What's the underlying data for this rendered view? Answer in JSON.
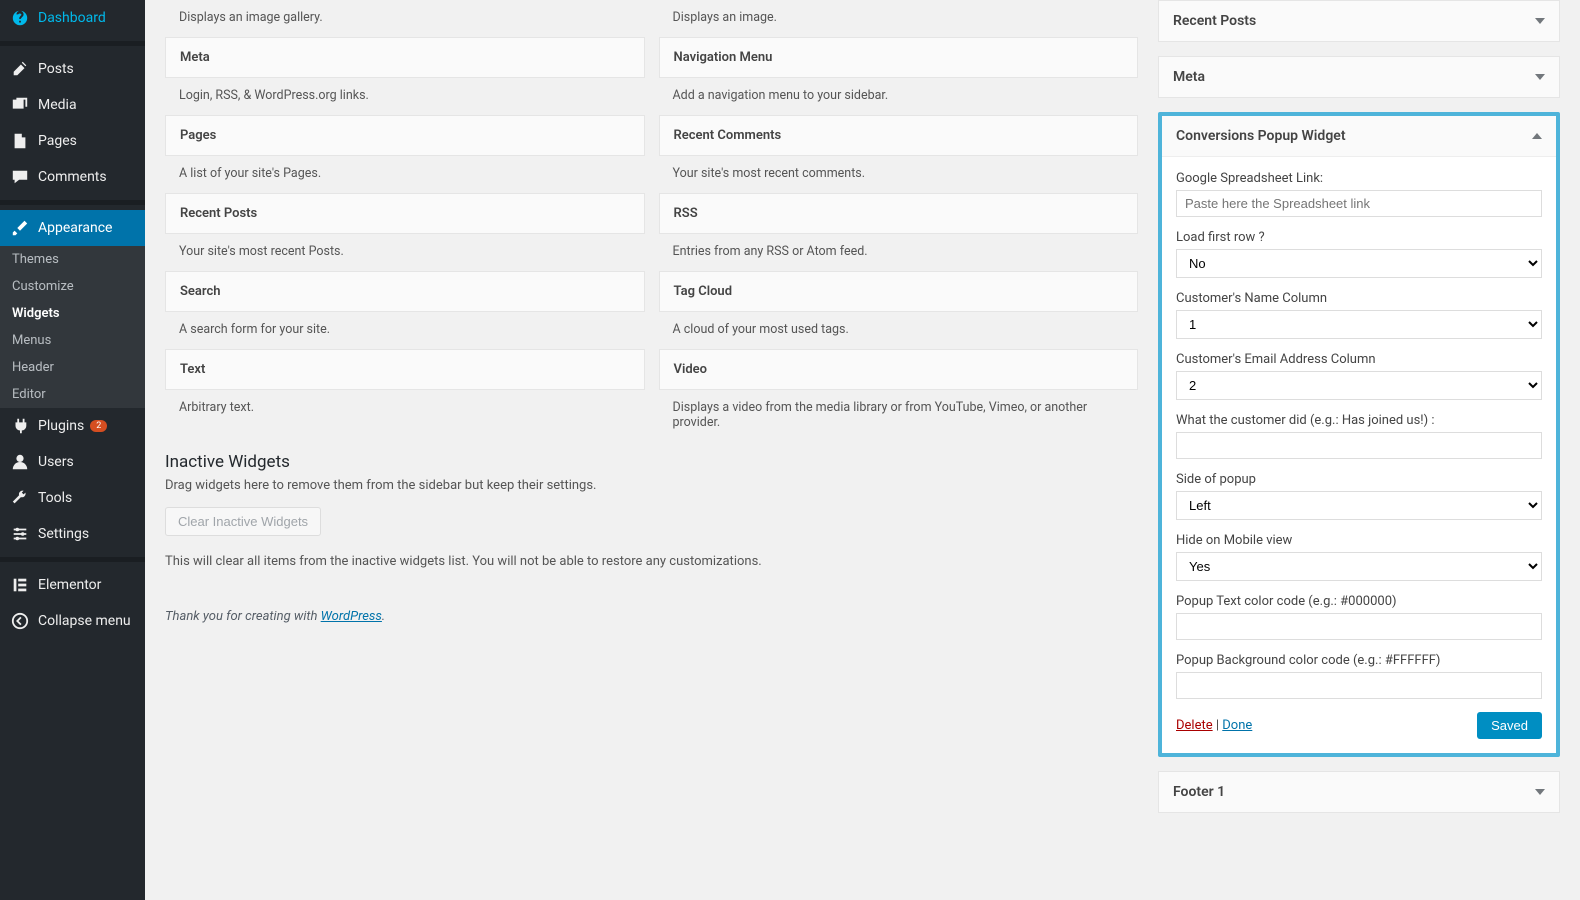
{
  "sidebar": {
    "items": [
      {
        "label": "Dashboard",
        "icon": "dashboard-icon"
      },
      {
        "label": "Posts",
        "icon": "pin-icon"
      },
      {
        "label": "Media",
        "icon": "media-icon"
      },
      {
        "label": "Pages",
        "icon": "page-icon"
      },
      {
        "label": "Comments",
        "icon": "comment-icon"
      },
      {
        "label": "Appearance",
        "icon": "brush-icon",
        "active": true
      },
      {
        "label": "Plugins",
        "icon": "plug-icon",
        "badge": "2"
      },
      {
        "label": "Users",
        "icon": "user-icon"
      },
      {
        "label": "Tools",
        "icon": "wrench-icon"
      },
      {
        "label": "Settings",
        "icon": "sliders-icon"
      },
      {
        "label": "Elementor",
        "icon": "elementor-icon"
      },
      {
        "label": "Collapse menu",
        "icon": "collapse-icon"
      }
    ],
    "sub": [
      {
        "label": "Themes"
      },
      {
        "label": "Customize"
      },
      {
        "label": "Widgets",
        "current": true
      },
      {
        "label": "Menus"
      },
      {
        "label": "Header"
      },
      {
        "label": "Editor"
      }
    ]
  },
  "availableWidgets": [
    {
      "title": "",
      "desc": "Displays an image gallery."
    },
    {
      "title": "",
      "desc": "Displays an image."
    },
    {
      "title": "Meta",
      "desc": "Login, RSS, & WordPress.org links."
    },
    {
      "title": "Navigation Menu",
      "desc": "Add a navigation menu to your sidebar."
    },
    {
      "title": "Pages",
      "desc": "A list of your site's Pages."
    },
    {
      "title": "Recent Comments",
      "desc": "Your site's most recent comments."
    },
    {
      "title": "Recent Posts",
      "desc": "Your site's most recent Posts."
    },
    {
      "title": "RSS",
      "desc": "Entries from any RSS or Atom feed."
    },
    {
      "title": "Search",
      "desc": "A search form for your site."
    },
    {
      "title": "Tag Cloud",
      "desc": "A cloud of your most used tags."
    },
    {
      "title": "Text",
      "desc": "Arbitrary text."
    },
    {
      "title": "Video",
      "desc": "Displays a video from the media library or from YouTube, Vimeo, or another provider."
    }
  ],
  "inactive": {
    "heading": "Inactive Widgets",
    "desc": "Drag widgets here to remove them from the sidebar but keep their settings.",
    "clear_btn": "Clear Inactive Widgets",
    "clear_desc": "This will clear all items from the inactive widgets list. You will not be able to restore any customizations."
  },
  "areas": {
    "recent_posts": "Recent Posts",
    "meta": "Meta",
    "footer1": "Footer 1"
  },
  "popupWidget": {
    "title": "Conversions Popup Widget",
    "fields": {
      "gs_label": "Google Spreadsheet Link:",
      "gs_placeholder": "Paste here the Spreadsheet link",
      "loadfirst_label": "Load first row ?",
      "loadfirst_value": "No",
      "name_col_label": "Customer's Name Column",
      "name_col_value": "1",
      "email_col_label": "Customer's Email Address Column",
      "email_col_value": "2",
      "action_label": "What the customer did (e.g.: Has joined us!) :",
      "side_label": "Side of popup",
      "side_value": "Left",
      "hide_mobile_label": "Hide on Mobile view",
      "hide_mobile_value": "Yes",
      "text_color_label": "Popup Text color code (e.g.: #000000)",
      "bg_color_label": "Popup Background color code (e.g.: #FFFFFF)"
    },
    "actions": {
      "delete": "Delete",
      "sep": " | ",
      "done": "Done",
      "saved": "Saved"
    }
  },
  "footer": {
    "thank_pre": "Thank you for creating with ",
    "thank_link": "WordPress",
    "thank_post": "."
  }
}
